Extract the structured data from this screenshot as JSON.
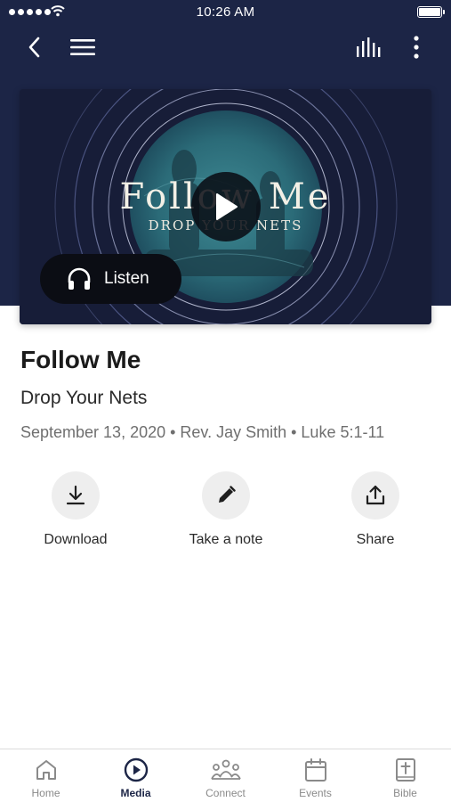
{
  "status_bar": {
    "time": "10:26 AM"
  },
  "header": {
    "back_icon": "chevron-left-icon",
    "menu_icon": "hamburger-menu-icon",
    "audio_icon": "equalizer-icon",
    "more_icon": "more-vertical-icon"
  },
  "hero": {
    "artwork_title": "Follow Me",
    "artwork_subtitle": "DROP YOUR NETS",
    "play_icon": "play-icon",
    "listen_label": "Listen",
    "listen_icon": "headphones-icon"
  },
  "sermon": {
    "title": "Follow Me",
    "subtitle": "Drop Your Nets",
    "meta": "September 13, 2020 • Rev. Jay Smith • Luke 5:1-11"
  },
  "actions": [
    {
      "label": "Download",
      "icon": "download-icon"
    },
    {
      "label": "Take a note",
      "icon": "pencil-icon"
    },
    {
      "label": "Share",
      "icon": "share-icon"
    }
  ],
  "tabs": [
    {
      "label": "Home",
      "icon": "home-icon",
      "active": false
    },
    {
      "label": "Media",
      "icon": "play-circle-icon",
      "active": true
    },
    {
      "label": "Connect",
      "icon": "people-icon",
      "active": false
    },
    {
      "label": "Events",
      "icon": "calendar-icon",
      "active": false
    },
    {
      "label": "Bible",
      "icon": "bible-icon",
      "active": false
    }
  ],
  "colors": {
    "header_background": "#1c2546",
    "active_tab": "#1c2546",
    "inactive_tab": "#8a8a8a",
    "action_circle": "#eeeeee"
  }
}
